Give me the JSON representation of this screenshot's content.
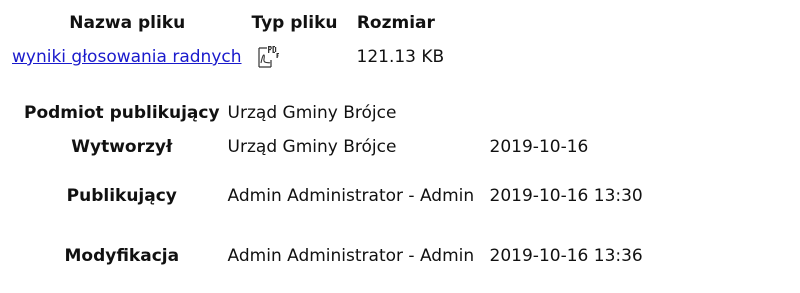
{
  "files": {
    "headers": {
      "name": "Nazwa pliku",
      "type": "Typ pliku",
      "size": "Rozmiar"
    },
    "rows": [
      {
        "name": "wyniki głosowania radnych",
        "type_icon": "pdf-file-icon",
        "size": "121.13 KB"
      }
    ]
  },
  "meta": {
    "publisher": {
      "label": "Podmiot publikujący",
      "value": "Urząd Gminy Brójce"
    },
    "created": {
      "label": "Wytworzył",
      "value": "Urząd Gminy Brójce",
      "date": "2019-10-16"
    },
    "published": {
      "label": "Publikujący",
      "value": "Admin Administrator - Admin",
      "date": "2019-10-16 13:30"
    },
    "modified": {
      "label": "Modyfikacja",
      "value": "Admin Administrator - Admin",
      "date": "2019-10-16 13:36"
    }
  },
  "colors": {
    "link": "#1a1acc",
    "text": "#111111"
  }
}
